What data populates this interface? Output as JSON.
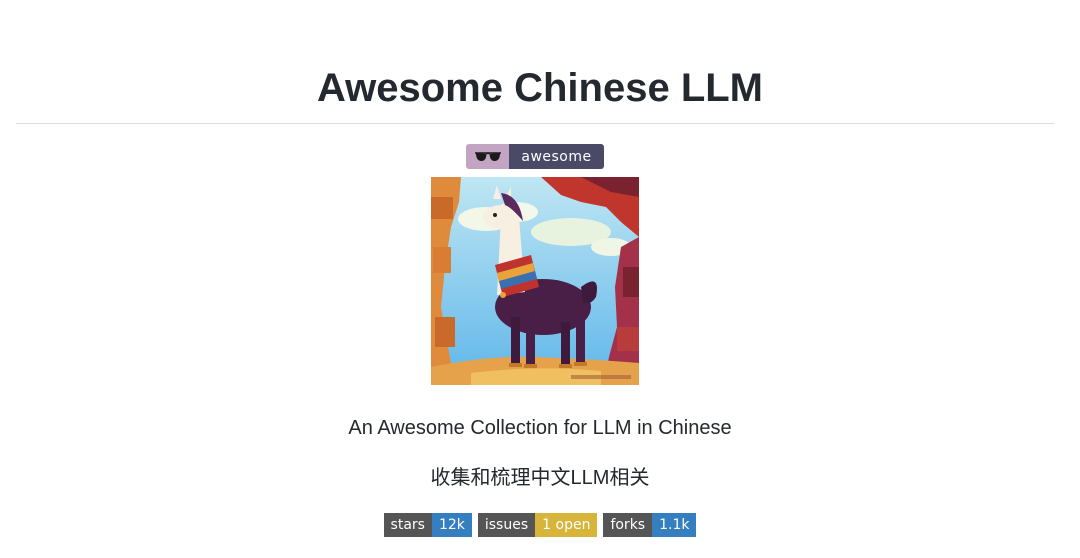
{
  "header": {
    "title": "Awesome Chinese LLM"
  },
  "awesome_badge": {
    "text": "awesome",
    "icon": "sunglasses-icon",
    "left_color": "#c3a5c3",
    "right_color": "#4a4a66"
  },
  "hero_image": {
    "subject": "llama-illustration-icon"
  },
  "description": {
    "english": "An Awesome Collection for LLM in Chinese",
    "chinese": "收集和梳理中文LLM相关"
  },
  "shields": [
    {
      "label": "stars",
      "value": "12k",
      "color": "#357ebf"
    },
    {
      "label": "issues",
      "value": "1 open",
      "color": "#d7b43a"
    },
    {
      "label": "forks",
      "value": "1.1k",
      "color": "#357ebf"
    }
  ]
}
